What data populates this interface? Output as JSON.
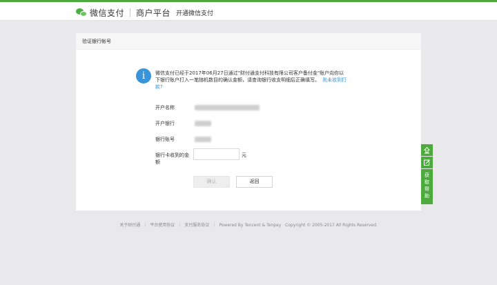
{
  "header": {
    "brand": "微信支付",
    "platform": "商户平台",
    "subtitle": "开通微信支付"
  },
  "card": {
    "title": "验证银行帐号",
    "notice": "微信支付已经于2017年06月27日通过\"财付通支付科技有限公司客户备付金\"账户向你以下银行账户打入一笔随机数目的确认金额，请查询银行收支明细后正确填写。",
    "notice_link": "尚未收到打款?"
  },
  "form": {
    "account_name_label": "开户名称",
    "bank_label": "开户银行",
    "account_no_label": "银行账号",
    "amount_label_line1": "银行卡收到的金",
    "amount_label_line2": "额",
    "amount_value": "",
    "amount_placeholder": "",
    "unit": "元",
    "confirm_label": "确认",
    "back_label": "返回"
  },
  "footer": {
    "links": [
      "关于财付通",
      "平台使用协议",
      "支付服务协议"
    ],
    "powered": "Powered By Tencent & Tenpay",
    "copyright": "Copyright © 2005-2017 All Rights Reserved."
  },
  "side": {
    "help": [
      "获",
      "取",
      "帮",
      "助"
    ]
  },
  "colors": {
    "accent": "#4dab3d",
    "info": "#3a94d9"
  },
  "icons": {
    "brand": "wechat-logo-icon",
    "info": "info-icon",
    "top": "back-to-top-icon",
    "feedback": "edit-icon"
  }
}
